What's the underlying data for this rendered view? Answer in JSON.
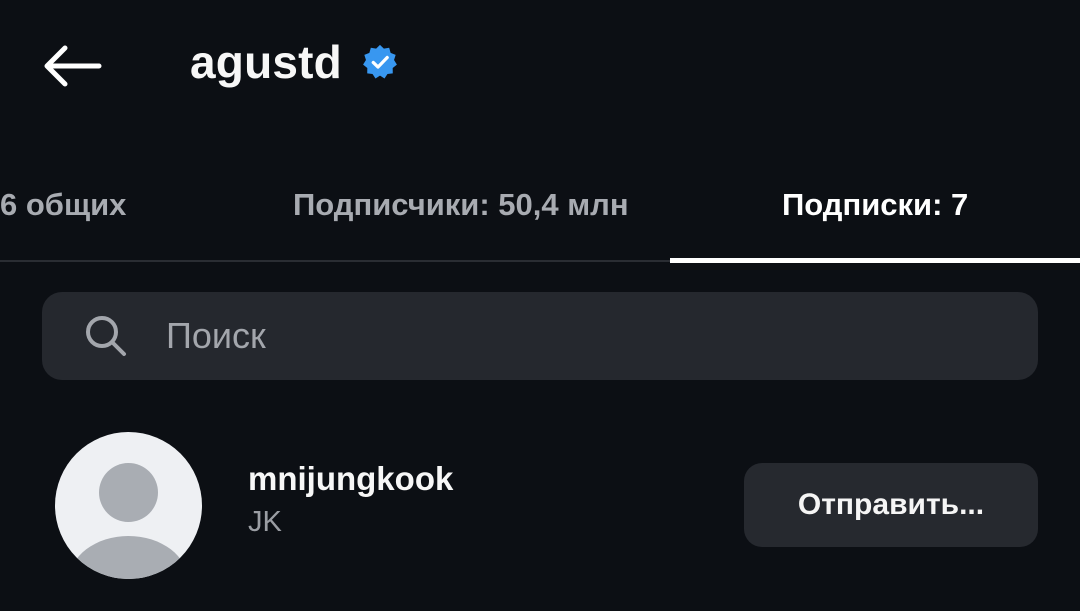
{
  "header": {
    "title": "agustd",
    "back_icon": "arrow-left-icon",
    "verified_icon": "verified-badge-icon",
    "verified_color": "#3897f0"
  },
  "tabs": [
    {
      "label": "6 общих",
      "active": false
    },
    {
      "label": "Подписчики: 50,4 млн",
      "active": false
    },
    {
      "label": "Подписки: 7",
      "active": true
    }
  ],
  "search": {
    "placeholder": "Поиск",
    "value": "",
    "icon": "search-icon"
  },
  "users": [
    {
      "username": "mnijungkook",
      "full_name": "JK",
      "avatar": "default-avatar-icon",
      "action_label": "Отправить..."
    }
  ],
  "colors": {
    "background": "#0c0f14",
    "surface": "#25282e",
    "text_primary": "#f5f5f5",
    "text_secondary": "#a8abb1",
    "accent": "#3897f0"
  }
}
